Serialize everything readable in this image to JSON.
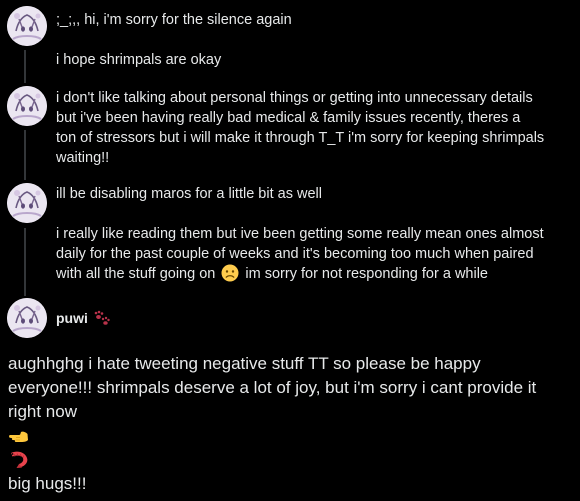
{
  "colors": {
    "background": "#000000",
    "text": "#e7e9ea",
    "thread_line": "#333639"
  },
  "tweets": [
    {
      "paragraphs": [
        [
          ";_;,, hi, i'm sorry for the silence again"
        ],
        [
          "i hope shrimpals are okay"
        ]
      ]
    },
    {
      "paragraphs": [
        [
          "i don't like talking about personal things or getting into unnecessary details",
          "but i've been having really bad medical & family issues recently, theres a",
          "ton of stressors but i will make it through T_T i'm sorry for keeping shrimpals",
          "waiting!!"
        ]
      ]
    },
    {
      "paragraphs": [
        [
          "ill be disabling maros for a little bit as well"
        ],
        [
          "i really like reading them but ive been getting some really mean ones almost",
          "daily for the past couple of weeks and it's becoming too much when paired"
        ]
      ],
      "last_line_before": "with all the stuff going on",
      "last_line_emoji": "slightly-frowning-face-icon",
      "last_line_after": "im sorry for not responding for a while"
    }
  ],
  "quoted_author": {
    "name": "puwi",
    "badge_icon": "paw-prints-icon"
  },
  "main_post": {
    "lines": [
      "aughhghg i hate tweeting negative stuff  TT so please be happy",
      "everyone!!! shrimpals deserve a lot of joy, but i'm sorry i cant provide it",
      "right now"
    ],
    "emoji_1": "backhand-pointing-left-icon",
    "emoji_2": "shrimp-icon",
    "closing": "big hugs!!!"
  }
}
